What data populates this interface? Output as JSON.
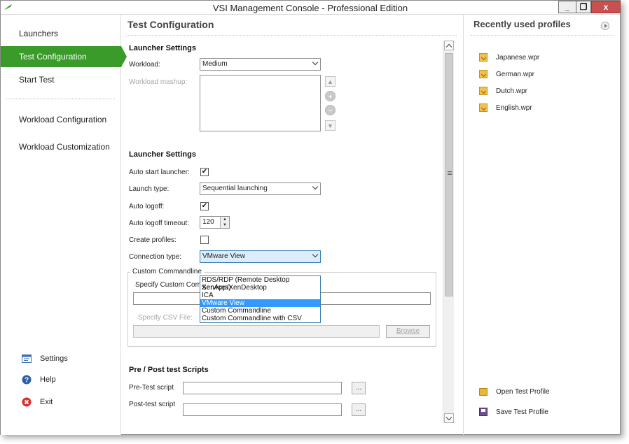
{
  "window": {
    "title": "VSI Management Console - Professional Edition"
  },
  "window_controls": {
    "minimize": "_",
    "restore": "❐",
    "close": "x"
  },
  "sidebar": {
    "items": [
      {
        "label": "Launchers"
      },
      {
        "label": "Test Configuration",
        "active": true
      },
      {
        "label": "Start Test"
      },
      {
        "label": "Workload Configuration"
      },
      {
        "label": "Workload Customization"
      }
    ],
    "bottom": [
      {
        "label": "Settings",
        "icon": "settings-icon"
      },
      {
        "label": "Help",
        "icon": "help-icon"
      },
      {
        "label": "Exit",
        "icon": "exit-icon"
      }
    ],
    "accent": "#3a9a2a"
  },
  "main": {
    "title": "Test Configuration",
    "launcher_settings_1": {
      "heading": "Launcher Settings",
      "workload_label": "Workload:",
      "workload_value": "Medium",
      "mashup_label": "Workload mashup:"
    },
    "launcher_settings_2": {
      "heading": "Launcher Settings",
      "auto_start_label": "Auto start launcher:",
      "auto_start_checked": "✔",
      "launch_type_label": "Launch type:",
      "launch_type_value": "Sequential launching",
      "auto_logoff_label": "Auto logoff:",
      "auto_logoff_checked": "✔",
      "auto_logoff_timeout_label": "Auto logoff timeout:",
      "auto_logoff_timeout_value": "120",
      "create_profiles_label": "Create profiles:",
      "connection_type_label": "Connection type:",
      "connection_type_value": "VMware View"
    },
    "connection_options": [
      "RDS/RDP (Remote Desktop Services)",
      "XenApp/XenDesktop",
      "ICA",
      "VMware View",
      "Custom Commandline",
      "Custom Commandline with CSV"
    ],
    "selected_connection_index": 3,
    "custom_commandline": {
      "legend": "Custom Commandline",
      "specify_label": "Specify Custom Comm",
      "csv_label": "Specify CSV File:",
      "browse_label": "Browse"
    },
    "scripts": {
      "heading": "Pre / Post test Scripts",
      "pre_label": "Pre-Test script",
      "post_label": "Post-test script",
      "browse_label": "..."
    }
  },
  "right_panel": {
    "title": "Recently used profiles",
    "profiles": [
      "Japanese.wpr",
      "German.wpr",
      "Dutch.wpr",
      "English.wpr"
    ],
    "open_label": "Open Test Profile",
    "save_label": "Save Test Profile"
  }
}
